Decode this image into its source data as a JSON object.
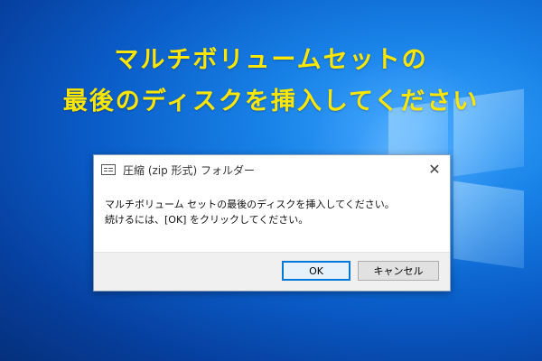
{
  "headline": {
    "line1": "マルチボリュームセットの",
    "line2": "最後のディスクを挿入してください"
  },
  "dialog": {
    "title": "圧縮 (zip 形式) フォルダー",
    "close_glyph": "✕",
    "message_line1": "マルチボリューム セットの最後のディスクを挿入してください。",
    "message_line2": "続けるには、[OK] をクリックしてください。",
    "ok_label": "OK",
    "cancel_label": "キャンセル"
  },
  "colors": {
    "headline": "#ffe600",
    "desktop": "#0a5cc8",
    "accent": "#0078d7"
  }
}
